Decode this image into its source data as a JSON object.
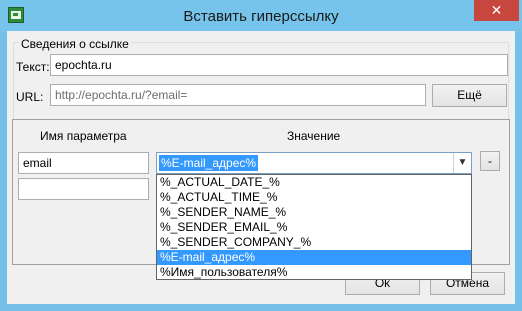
{
  "window": {
    "title": "Вставить гиперссылку",
    "close_glyph": "✕",
    "app_icon": "hyperlink-app-icon"
  },
  "link_info": {
    "legend": "Сведения о ссылке",
    "text_label": "Текст:",
    "text_value": "epochta.ru",
    "url_label": "URL:",
    "url_value": "http://epochta.ru/?email=",
    "more_button": "Ещё"
  },
  "params": {
    "name_header": "Имя параметра",
    "value_header": "Значение",
    "rows": [
      {
        "name": "email",
        "value": "%E-mail_адрес%"
      },
      {
        "name": "",
        "value": ""
      }
    ],
    "remove_button": "-"
  },
  "dropdown": {
    "selected": "%E-mail_адрес%",
    "options": [
      "%_ACTUAL_DATE_%",
      "%_ACTUAL_TIME_%",
      "%_SENDER_NAME_%",
      "%_SENDER_EMAIL_%",
      "%_SENDER_COMPANY_%",
      "%E-mail_адрес%",
      "%Имя_пользователя%"
    ]
  },
  "footer": {
    "ok_button": "Ok",
    "cancel_button": "Отмена"
  }
}
